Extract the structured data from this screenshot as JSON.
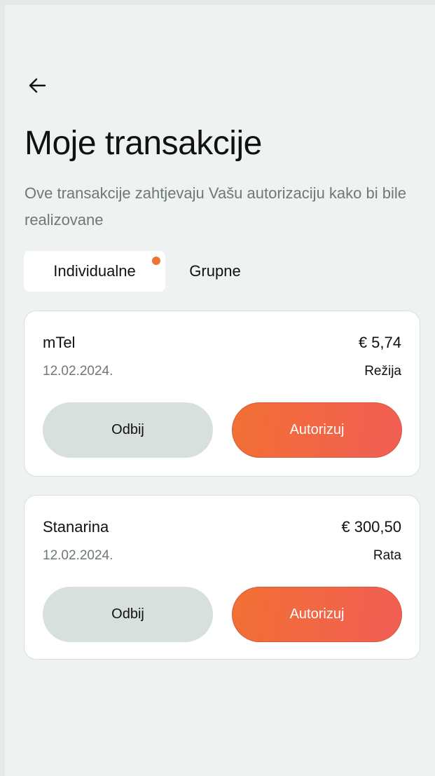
{
  "header": {
    "back_icon": "arrow-left-icon",
    "title": "Moje transakcije",
    "subtitle": "Ove transakcije zahtjevaju Vašu autorizaciju kako bi bile realizovane"
  },
  "tabs": [
    {
      "label": "Individualne",
      "active": true,
      "has_notification": true
    },
    {
      "label": "Grupne",
      "active": false
    }
  ],
  "colors": {
    "notification_dot": "#f07431",
    "authorize_gradient_start": "#f27034",
    "authorize_gradient_end": "#f15e55",
    "reject_bg": "#d8e0dd"
  },
  "transactions": [
    {
      "merchant": "mTel",
      "amount": "€ 5,74",
      "date": "12.02.2024.",
      "category": "Režija",
      "reject_label": "Odbij",
      "authorize_label": "Autorizuj"
    },
    {
      "merchant": "Stanarina",
      "amount": "€ 300,50",
      "date": "12.02.2024.",
      "category": "Rata",
      "reject_label": "Odbij",
      "authorize_label": "Autorizuj"
    }
  ]
}
